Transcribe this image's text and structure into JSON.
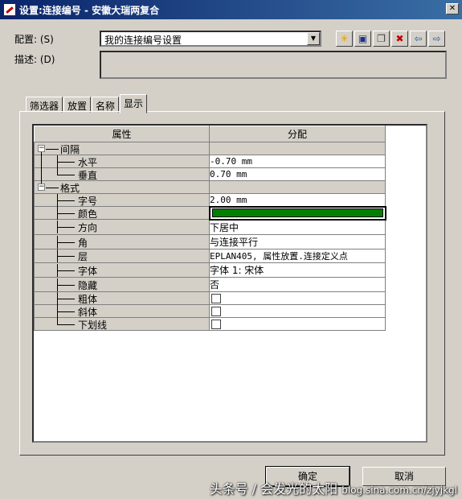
{
  "window": {
    "title": "设置:连接编号 - 安徽大瑞两复合",
    "close_label": "✕"
  },
  "config": {
    "label": "配置: (S)",
    "value": "我的连接编号设置",
    "desc_label": "描述: (D)"
  },
  "toolbar": {
    "icons": [
      "new-icon",
      "save-icon",
      "copy-icon",
      "delete-icon",
      "import-icon",
      "export-icon"
    ],
    "glyphs": [
      "✳",
      "▣",
      "❐",
      "✖",
      "⇦",
      "⇨"
    ]
  },
  "tabs": [
    {
      "label": "筛选器"
    },
    {
      "label": "放置"
    },
    {
      "label": "名称"
    },
    {
      "label": "显示",
      "active": true
    }
  ],
  "grid": {
    "col_property": "属性",
    "col_value": "分配",
    "groups": {
      "spacing": {
        "label": "间隔",
        "horizontal": {
          "label": "水平",
          "value": "-0.70 mm"
        },
        "vertical": {
          "label": "垂直",
          "value": "0.70 mm"
        }
      },
      "format": {
        "label": "格式",
        "font_size": {
          "label": "字号",
          "value": "2.00 mm"
        },
        "color": {
          "label": "颜色",
          "value": "#008000"
        },
        "direction": {
          "label": "方向",
          "value": "下居中"
        },
        "angle": {
          "label": "角",
          "value": "与连接平行"
        },
        "layer": {
          "label": "层",
          "value": "EPLAN405, 属性放置.连接定义点"
        },
        "font": {
          "label": "字体",
          "value": "字体 1: 宋体"
        },
        "hidden": {
          "label": "隐藏",
          "value": "否"
        },
        "bold": {
          "label": "粗体",
          "checked": false
        },
        "italic": {
          "label": "斜体",
          "checked": false
        },
        "underline": {
          "label": "下划线",
          "checked": false
        }
      }
    }
  },
  "buttons": {
    "ok": "确定",
    "cancel": "取消"
  },
  "watermark": {
    "main": "头条号 / 会发光的太阳",
    "url": "blog.sina.com.cn/zjyjkgl"
  }
}
